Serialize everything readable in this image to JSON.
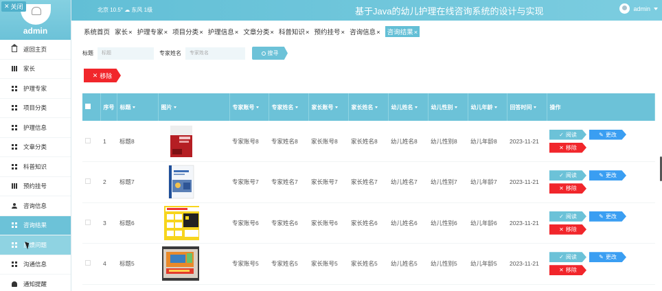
{
  "sidebar": {
    "close_label": "关闭",
    "user_name": "admin",
    "items": [
      {
        "label": "返回主页",
        "icon": "home-icon"
      },
      {
        "label": "家长",
        "icon": "bars-icon"
      },
      {
        "label": "护理专家",
        "icon": "grid-icon"
      },
      {
        "label": "项目分类",
        "icon": "grid-icon"
      },
      {
        "label": "护理信息",
        "icon": "grid-icon"
      },
      {
        "label": "文章分类",
        "icon": "grid-icon"
      },
      {
        "label": "科普知识",
        "icon": "grid-icon"
      },
      {
        "label": "预约挂号",
        "icon": "bars-icon"
      },
      {
        "label": "咨询信息",
        "icon": "user-icon"
      },
      {
        "label": "咨询结果",
        "icon": "grid-icon"
      },
      {
        "label": "反馈问题",
        "icon": "grid-icon"
      },
      {
        "label": "沟通信息",
        "icon": "grid-icon"
      },
      {
        "label": "通知提醒",
        "icon": "bell-icon"
      }
    ]
  },
  "header": {
    "weather": "北京 10.5° ☁ 东风 1级",
    "title": "基于Java的幼儿护理在线咨询系统的设计与实现",
    "user": "admin"
  },
  "tabs": [
    {
      "label": "系统首页",
      "closable": false
    },
    {
      "label": "家长",
      "closable": true
    },
    {
      "label": "护理专家",
      "closable": true
    },
    {
      "label": "项目分类",
      "closable": true
    },
    {
      "label": "护理信息",
      "closable": true
    },
    {
      "label": "文章分类",
      "closable": true
    },
    {
      "label": "科普知识",
      "closable": true
    },
    {
      "label": "预约挂号",
      "closable": true
    },
    {
      "label": "咨询信息",
      "closable": true
    },
    {
      "label": "咨询结果",
      "closable": true,
      "active": true
    }
  ],
  "search": {
    "title_label": "标题",
    "title_placeholder": "标题",
    "expert_label": "专家姓名",
    "expert_placeholder": "专家姓名",
    "button_label": "搜寻"
  },
  "toolbar": {
    "remove_label": "移除"
  },
  "table": {
    "headers": [
      "序号",
      "标题",
      "图片",
      "专家账号",
      "专家姓名",
      "家长账号",
      "家长姓名",
      "幼儿姓名",
      "幼儿性别",
      "幼儿年龄",
      "回答时间",
      "操作"
    ],
    "read_label": "阅读",
    "edit_label": "更改",
    "delete_label": "移除",
    "rows": [
      {
        "no": "1",
        "title": "标题8",
        "expert_account": "专家账号8",
        "expert_name": "专家姓名8",
        "parent_account": "家长账号8",
        "parent_name": "家长姓名8",
        "child_name": "幼儿姓名8",
        "child_gender": "幼儿性别8",
        "child_age": "幼儿年龄8",
        "answer_time": "2023-11-21",
        "thumb": "book-red"
      },
      {
        "no": "2",
        "title": "标题7",
        "expert_account": "专家账号7",
        "expert_name": "专家姓名7",
        "parent_account": "家长账号7",
        "parent_name": "家长姓名7",
        "child_name": "幼儿姓名7",
        "child_gender": "幼儿性别7",
        "child_age": "幼儿年龄7",
        "answer_time": "2023-11-21",
        "thumb": "book-blue"
      },
      {
        "no": "3",
        "title": "标题6",
        "expert_account": "专家账号6",
        "expert_name": "专家姓名6",
        "parent_account": "家长账号6",
        "parent_name": "家长姓名6",
        "child_name": "幼儿姓名6",
        "child_gender": "幼儿性别6",
        "child_age": "幼儿年龄6",
        "answer_time": "2023-11-21",
        "thumb": "microbit-yellow"
      },
      {
        "no": "4",
        "title": "标题5",
        "expert_account": "专家账号5",
        "expert_name": "专家姓名5",
        "parent_account": "家长账号5",
        "parent_name": "家长姓名5",
        "child_name": "幼儿姓名5",
        "child_gender": "幼儿性别5",
        "child_age": "幼儿年龄5",
        "answer_time": "2023-11-21",
        "thumb": "kit-box"
      }
    ]
  },
  "colors": {
    "accent": "#6cc2d8",
    "danger": "#f1262b",
    "edit": "#3a9ef2"
  }
}
